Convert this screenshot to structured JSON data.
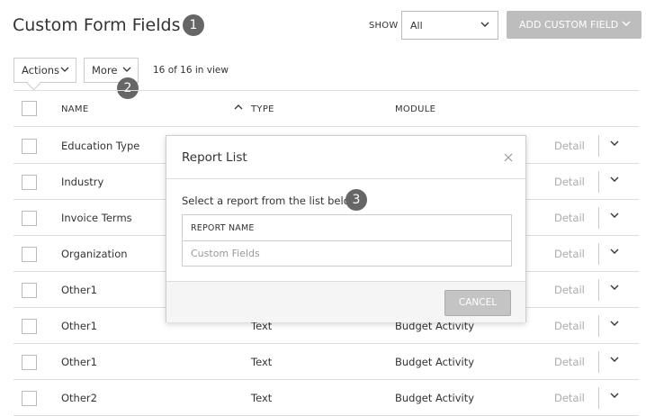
{
  "page": {
    "title": "Custom Form Fields"
  },
  "steps": [
    "1",
    "2",
    "3"
  ],
  "toolbar": {
    "show_label": "SHOW",
    "show_value": "All",
    "add_button": "ADD CUSTOM FIELD",
    "actions_label": "Actions",
    "more_label": "More",
    "in_view": "16 of 16 in view"
  },
  "table": {
    "columns": {
      "name": "NAME",
      "type": "TYPE",
      "module": "MODULE"
    },
    "rows": [
      {
        "name": "Education Type",
        "type": "",
        "module": "",
        "detail": "Detail"
      },
      {
        "name": "Industry",
        "type": "",
        "module": "",
        "detail": "Detail"
      },
      {
        "name": "Invoice Terms",
        "type": "",
        "module": "",
        "detail": "Detail"
      },
      {
        "name": "Organization",
        "type": "",
        "module": "",
        "detail": "Detail"
      },
      {
        "name": "Other1",
        "type": "",
        "module": "",
        "detail": "Detail"
      },
      {
        "name": "Other1",
        "type": "Text",
        "module": "Budget Activity",
        "detail": "Detail"
      },
      {
        "name": "Other1",
        "type": "Text",
        "module": "Budget Activity",
        "detail": "Detail"
      },
      {
        "name": "Other2",
        "type": "Text",
        "module": "Budget Activity",
        "detail": "Detail"
      }
    ]
  },
  "modal": {
    "title": "Report List",
    "instruction": "Select a report from the list below",
    "column_header": "REPORT NAME",
    "report_placeholder": "Custom Fields",
    "cancel_label": "CANCEL"
  },
  "icons": {
    "chevron": "chevron-down-icon",
    "sort": "sort-ascending-icon",
    "close": "close-icon"
  },
  "colors": {
    "step_badge": "#666666",
    "add_button_bg": "#bdbdbd",
    "cancel_button_bg": "#c4c4c4"
  }
}
